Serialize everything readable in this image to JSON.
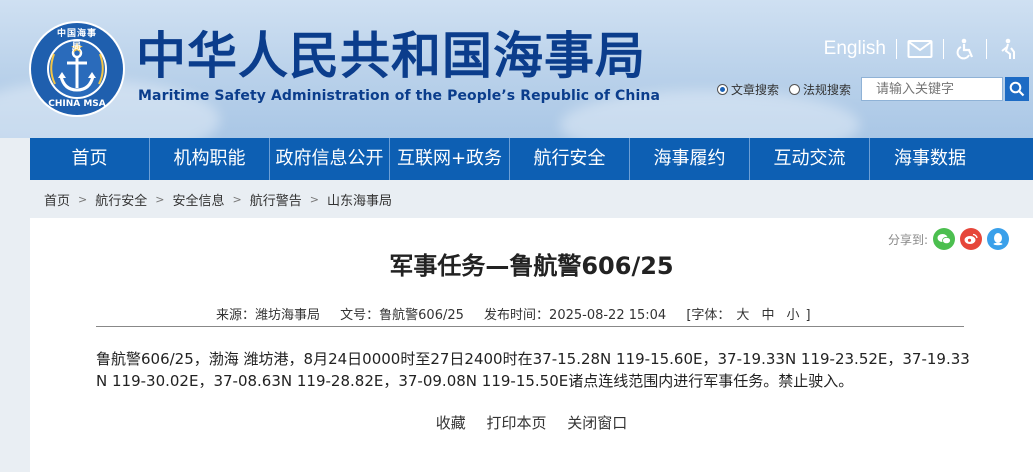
{
  "header": {
    "title_cn": "中华人民共和国海事局",
    "title_en": "Maritime Safety Administration of the People’s Republic of China",
    "logo_top_text": "中国海事局",
    "logo_bottom_text": "CHINA MSA",
    "english_link": "English",
    "search": {
      "option_article": "文章搜索",
      "option_regulation": "法规搜索",
      "selected": "文章搜索",
      "placeholder": "请输入关键字"
    }
  },
  "nav": {
    "items": [
      "首页",
      "机构职能",
      "政府信息公开",
      "互联网+政务",
      "航行安全",
      "海事履约",
      "互动交流",
      "海事数据"
    ]
  },
  "breadcrumb": {
    "items": [
      "首页",
      "航行安全",
      "安全信息",
      "航行警告",
      "山东海事局"
    ]
  },
  "article": {
    "share_label": "分享到:",
    "title": "军事任务—鲁航警606/25",
    "meta": {
      "source": "来源：潍坊海事局",
      "doc_no": "文号：鲁航警606/25",
      "publish_time": "发布时间：2025-08-22 15:04",
      "font_label": "[字体：",
      "font_large": "大",
      "font_medium": "中",
      "font_small": "小",
      "font_close": "]"
    },
    "body": "鲁航警606/25，渤海 潍坊港，8月24日0000时至27日2400时在37-15.28N 119-15.60E，37-19.33N 119-23.52E，37-19.33N 119-30.02E，37-08.63N 119-28.82E，37-09.08N 119-15.50E诸点连线范围内进行军事任务。禁止驶入。",
    "actions": {
      "favorite": "收藏",
      "print": "打印本页",
      "close": "关闭窗口"
    }
  },
  "colors": {
    "brand_blue": "#0d5fb3",
    "title_blue": "#0b3d8c",
    "wechat_green": "#4cbf4f",
    "weibo_red": "#e6463a",
    "qq_blue": "#3aa0ea"
  }
}
